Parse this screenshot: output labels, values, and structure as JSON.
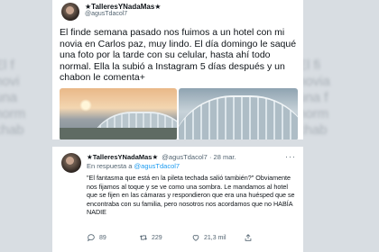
{
  "tweet": {
    "name": "★TalleresYNadaMas★",
    "handle": "@agusTdacol7",
    "text": "El finde semana pasado nos fuimos a un hotel con mi novia en Carlos paz, muy lindo. El día domingo le saqué una foto por la tarde con su celular, hasta ahí todo normal. Ella la subió a Instagram 5 días después y un chabon le comenta+",
    "more": "···"
  },
  "reply": {
    "name": "★TalleresYNadaMas★",
    "handle": "@agusTdacol7",
    "date": "· 28 mar.",
    "replying_prefix": "En respuesta a",
    "replying_to": "@agusTdacol7",
    "text": "\"El fantasma que está en la pileta techada salió también?\" Obviamente nos fijamos al toque y se ve como una sombra. Le mandamos al hotel que se fijen en las cámaras y respondieron que era una huésped que se encontraba con su familia, pero nosotros nos acordamos que no HABÍA NADIE",
    "more": "···",
    "replies": "89",
    "retweets": "229",
    "likes": "21,3 mil"
  },
  "colors": {
    "accent": "#1d9bf0",
    "text": "#0f1419",
    "muted": "#536471"
  },
  "icons": [
    "reply-icon",
    "retweet-icon",
    "heart-icon",
    "share-icon",
    "more-icon"
  ]
}
